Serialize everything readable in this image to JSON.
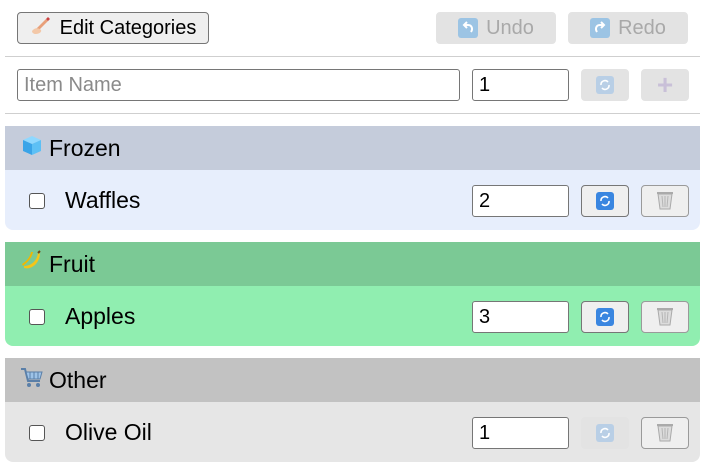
{
  "toolbar": {
    "edit_categories_label": "Edit Categories",
    "edit_icon": "writing-hand-icon",
    "undo_label": "Undo",
    "redo_label": "Redo"
  },
  "add_item": {
    "name_placeholder": "Item Name",
    "quantity_value": "1"
  },
  "categories": [
    {
      "name": "Frozen",
      "icon": "ice-cube-icon",
      "header_color": "#c5ccdb",
      "body_color": "#e7eefc",
      "items": [
        {
          "label": "Waffles",
          "quantity": "2",
          "checked": false
        }
      ]
    },
    {
      "name": "Fruit",
      "icon": "banana-icon",
      "header_color": "#7bc995",
      "body_color": "#90eeb0",
      "items": [
        {
          "label": "Apples",
          "quantity": "3",
          "checked": false
        }
      ]
    },
    {
      "name": "Other",
      "icon": "shopping-cart-icon",
      "header_color": "#c2c2c2",
      "body_color": "#e6e6e6",
      "items": [
        {
          "label": "Olive Oil",
          "quantity": "1",
          "checked": false
        }
      ]
    }
  ]
}
